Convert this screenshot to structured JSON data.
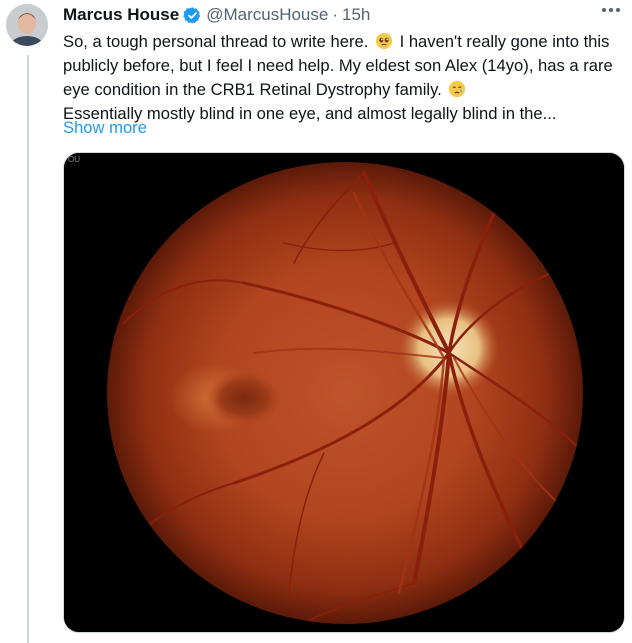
{
  "tweet": {
    "author_name": "Marcus House",
    "handle": "@MarcusHouse",
    "separator": "·",
    "time": "15h",
    "lines": [
      "So, a tough personal thread to write here.",
      "I haven't really gone into this",
      "publicly before, but I feel I need help. My eldest son Alex (14yo), has a rare",
      "eye condition in the CRB1 Retinal Dystrophy family.",
      "Essentially mostly blind in one eye, and almost legally blind in the..."
    ],
    "show_more": "Show more",
    "media_corner_text": "OU"
  },
  "icons": {
    "verified": "verified-badge-icon",
    "pleading": "pleading-face-emoji",
    "crying": "crying-face-emoji",
    "more": "more-options-icon"
  },
  "colors": {
    "link": "#1d9bf0",
    "verified": "#1d9bf0",
    "secondary_text": "#536471",
    "thread_line": "#cfd9de"
  }
}
